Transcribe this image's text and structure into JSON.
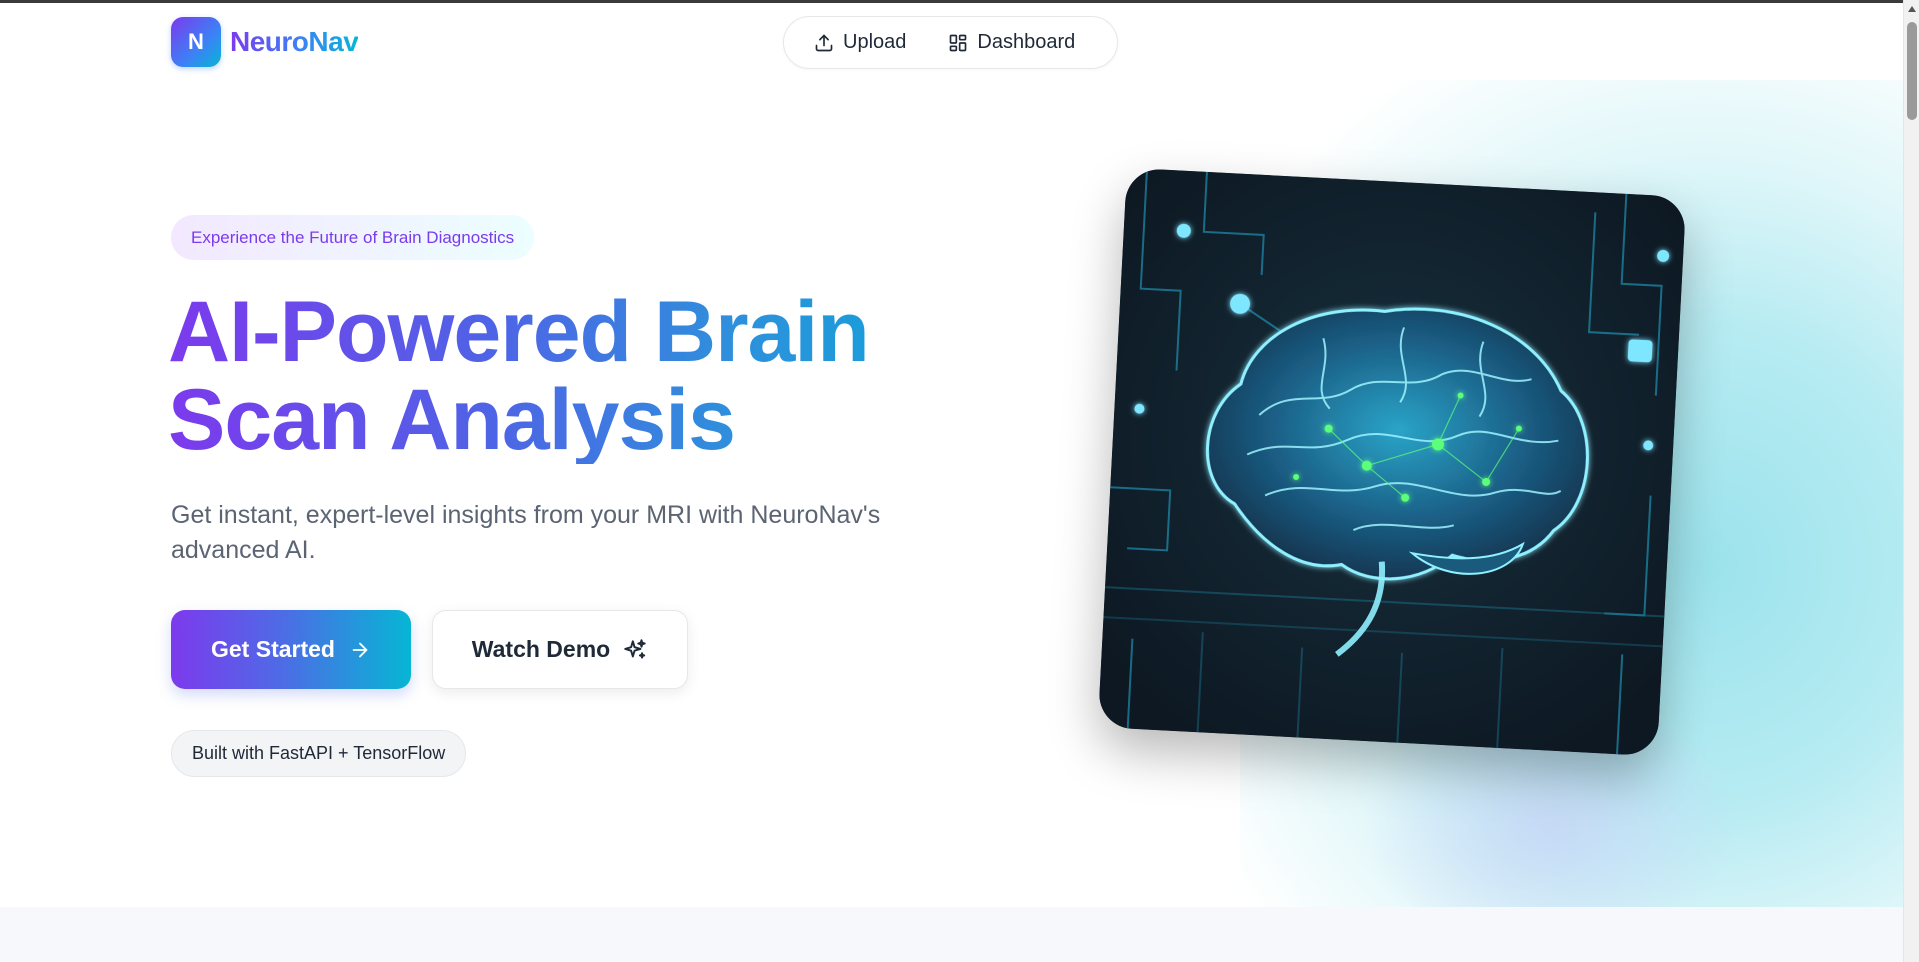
{
  "brand": {
    "logo_letter": "N",
    "name": "NeuroNav"
  },
  "nav": {
    "items": [
      {
        "label": "Upload",
        "icon": "upload-icon"
      },
      {
        "label": "Dashboard",
        "icon": "dashboard-grid-icon"
      }
    ]
  },
  "hero": {
    "badge": "Experience the Future of Brain Diagnostics",
    "title_line1": "AI-Powered Brain",
    "title_line2": "Scan Analysis",
    "subtitle": "Get instant, expert-level insights from your MRI with NeuroNav's advanced AI.",
    "primary_button": {
      "label": "Get Started",
      "icon": "arrow-right-icon"
    },
    "secondary_button": {
      "label": "Watch Demo",
      "icon": "sparkles-icon"
    },
    "tech_pill": "Built with FastAPI + TensorFlow",
    "image": {
      "subject": "glowing-brain-circuit-illustration"
    }
  },
  "colors": {
    "purple": "#7c3aed",
    "blue": "#3b82f6",
    "cyan": "#06b6d4",
    "text_dark": "#1f2937",
    "text_muted": "#5b6472"
  }
}
